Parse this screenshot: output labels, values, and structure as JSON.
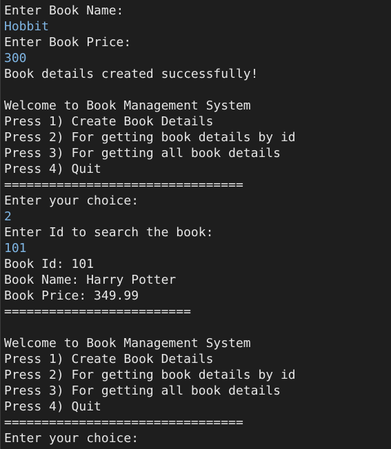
{
  "console": {
    "lines": [
      {
        "text": "Enter Book Name:",
        "kind": "output"
      },
      {
        "text": "Hobbit",
        "kind": "input"
      },
      {
        "text": "Enter Book Price:",
        "kind": "output"
      },
      {
        "text": "300",
        "kind": "input"
      },
      {
        "text": "Book details created successfully!",
        "kind": "output"
      },
      {
        "text": "",
        "kind": "blank"
      },
      {
        "text": "Welcome to Book Management System",
        "kind": "output"
      },
      {
        "text": "Press 1) Create Book Details",
        "kind": "output"
      },
      {
        "text": "Press 2) For getting book details by id",
        "kind": "output"
      },
      {
        "text": "Press 3) For getting all book details",
        "kind": "output"
      },
      {
        "text": "Press 4) Quit",
        "kind": "output"
      },
      {
        "text": "================================",
        "kind": "output"
      },
      {
        "text": "Enter your choice:",
        "kind": "output"
      },
      {
        "text": "2",
        "kind": "input"
      },
      {
        "text": "Enter Id to search the book:",
        "kind": "output"
      },
      {
        "text": "101",
        "kind": "input"
      },
      {
        "text": "Book Id: 101",
        "kind": "output"
      },
      {
        "text": "Book Name: Harry Potter",
        "kind": "output"
      },
      {
        "text": "Book Price: 349.99",
        "kind": "output"
      },
      {
        "text": "=========================",
        "kind": "output"
      },
      {
        "text": "",
        "kind": "blank"
      },
      {
        "text": "Welcome to Book Management System",
        "kind": "output"
      },
      {
        "text": "Press 1) Create Book Details",
        "kind": "output"
      },
      {
        "text": "Press 2) For getting book details by id",
        "kind": "output"
      },
      {
        "text": "Press 3) For getting all book details",
        "kind": "output"
      },
      {
        "text": "Press 4) Quit",
        "kind": "output"
      },
      {
        "text": "================================",
        "kind": "output"
      },
      {
        "text": "Enter your choice:",
        "kind": "output"
      }
    ],
    "colors": {
      "background": "#1e1e1e",
      "output_text": "#e6e6e6",
      "input_text": "#7fb5e3"
    }
  }
}
